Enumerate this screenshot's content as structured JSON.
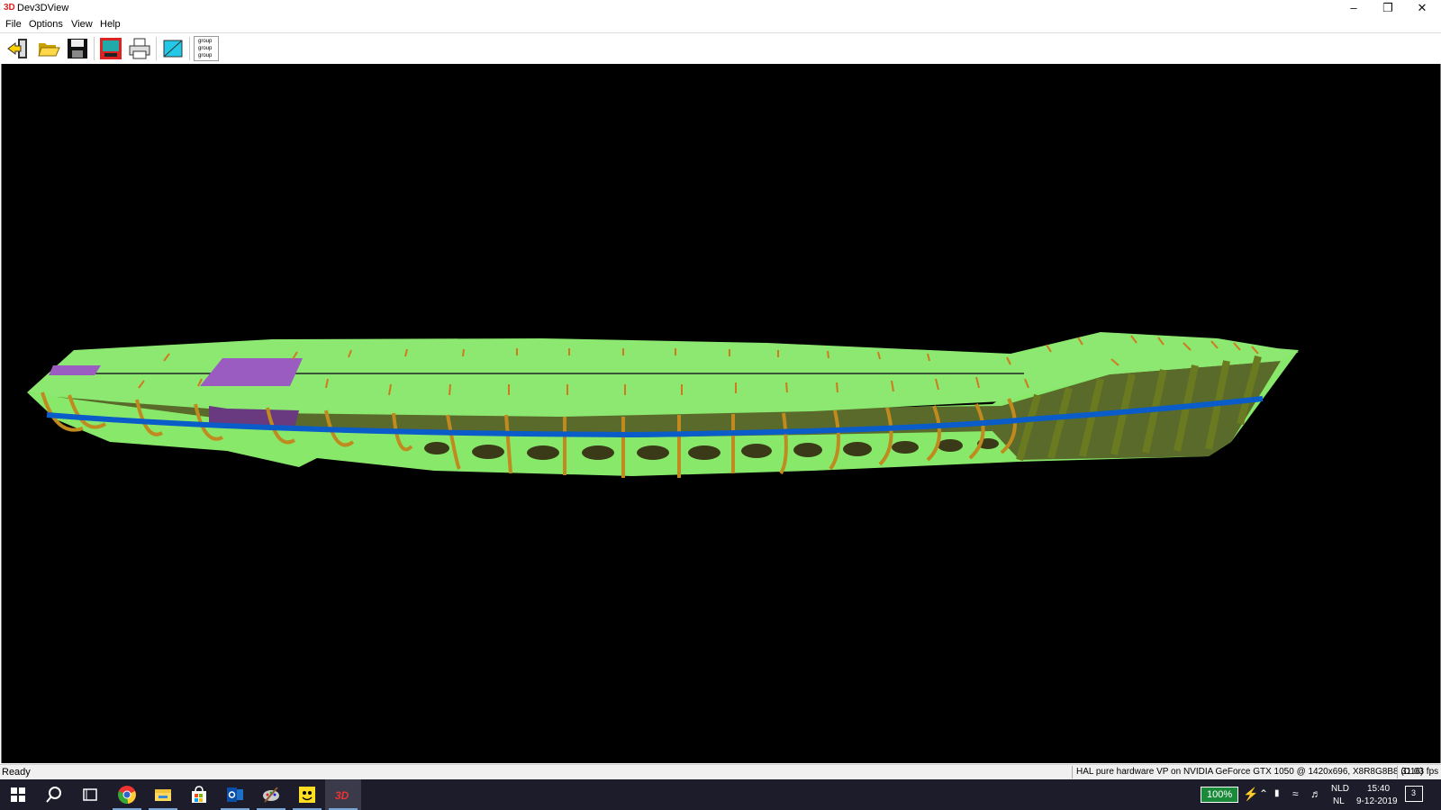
{
  "window": {
    "app_icon": "3D",
    "title": "Dev3DView",
    "controls": [
      "minimize-icon",
      "restore-icon",
      "close-icon"
    ]
  },
  "menu": [
    "File",
    "Options",
    "View",
    "Help"
  ],
  "toolbar": {
    "buttons": [
      "exit-icon",
      "open-folder-icon",
      "save-disk-icon",
      "screen-capture-icon",
      "print-icon",
      "color-box-icon",
      "group-list-icon"
    ],
    "group_list_labels": [
      "group",
      "group",
      "group"
    ]
  },
  "viewport": {
    "background": "#000000",
    "model_colors": {
      "hull": "#88e86a",
      "frames": "#c08a1e",
      "keel_line": "#0a5cc8",
      "plates": "#9a5cc0",
      "inner": "#5a6a2a"
    }
  },
  "status": {
    "left": "Ready",
    "renderer": "HAL pure hardware VP on NVIDIA GeForce GTX 1050 @ 1420x696, X8R8G8B8 (D16)",
    "fps": "31.03 fps"
  },
  "taskbar": {
    "apps": [
      "start-icon",
      "search-icon",
      "task-view-icon",
      "chrome-icon",
      "file-explorer-icon",
      "store-icon",
      "outlook-icon",
      "paint-icon",
      "smiley-app-icon",
      "dev3dview-icon"
    ],
    "battery": "100%",
    "language": "NLD",
    "layout": "NL",
    "time": "15:40",
    "date": "9-12-2019",
    "notification_count": "3"
  }
}
